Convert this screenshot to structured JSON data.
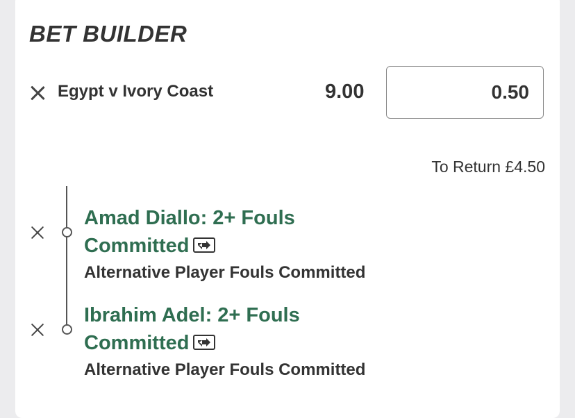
{
  "bet_builder": {
    "title": "BET BUILDER",
    "event": "Egypt v Ivory Coast",
    "odds": "9.00",
    "stake": "0.50",
    "to_return": "To Return £4.50",
    "selections": [
      {
        "line1": "Amad Diallo: 2+ Fouls",
        "line2": "Committed",
        "market": "Alternative Player Fouls Committed"
      },
      {
        "line1": "Ibrahim Adel: 2+ Fouls",
        "line2": "Committed",
        "market": "Alternative Player Fouls Committed"
      }
    ]
  },
  "colors": {
    "selection_green": "#2f6e51",
    "text_dark": "#333333"
  },
  "icons": {
    "remove": "close-icon",
    "swap": "swap-icon"
  }
}
